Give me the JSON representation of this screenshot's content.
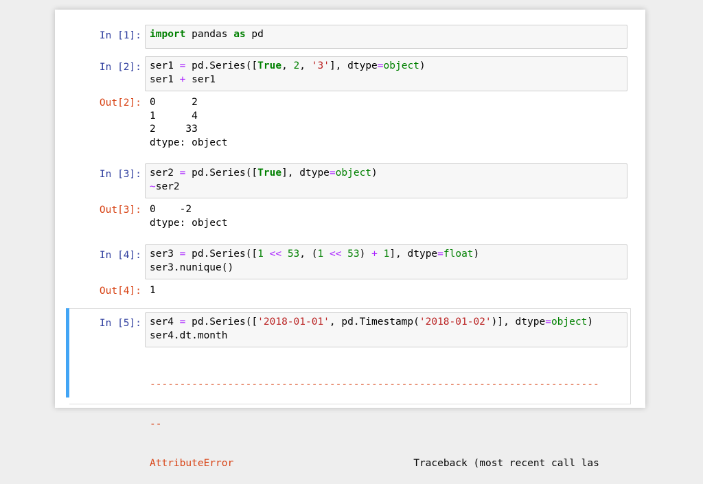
{
  "cells": [
    {
      "in_prompt": "In [1]:",
      "code": [
        [
          {
            "t": "import",
            "c": "kw"
          },
          {
            "t": " pandas "
          },
          {
            "t": "as",
            "c": "kw"
          },
          {
            "t": " pd"
          }
        ]
      ]
    },
    {
      "in_prompt": "In [2]:",
      "code": [
        [
          {
            "t": "ser1 "
          },
          {
            "t": "=",
            "c": "op"
          },
          {
            "t": " pd.Series(["
          },
          {
            "t": "True",
            "c": "kw"
          },
          {
            "t": ", "
          },
          {
            "t": "2",
            "c": "num"
          },
          {
            "t": ", "
          },
          {
            "t": "'3'",
            "c": "str"
          },
          {
            "t": "], dtype"
          },
          {
            "t": "=",
            "c": "op"
          },
          {
            "t": "object",
            "c": "cls"
          },
          {
            "t": ")"
          }
        ],
        [
          {
            "t": "ser1 "
          },
          {
            "t": "+",
            "c": "op"
          },
          {
            "t": " ser1"
          }
        ]
      ],
      "out_prompt": "Out[2]:",
      "output": [
        "0      2",
        "1      4",
        "2     33",
        "dtype: object"
      ]
    },
    {
      "in_prompt": "In [3]:",
      "code": [
        [
          {
            "t": "ser2 "
          },
          {
            "t": "=",
            "c": "op"
          },
          {
            "t": " pd.Series(["
          },
          {
            "t": "True",
            "c": "kw"
          },
          {
            "t": "], dtype"
          },
          {
            "t": "=",
            "c": "op"
          },
          {
            "t": "object",
            "c": "cls"
          },
          {
            "t": ")"
          }
        ],
        [
          {
            "t": "~",
            "c": "op"
          },
          {
            "t": "ser2"
          }
        ]
      ],
      "out_prompt": "Out[3]:",
      "output": [
        "0    -2",
        "dtype: object"
      ]
    },
    {
      "in_prompt": "In [4]:",
      "code": [
        [
          {
            "t": "ser3 "
          },
          {
            "t": "=",
            "c": "op"
          },
          {
            "t": " pd.Series(["
          },
          {
            "t": "1",
            "c": "num"
          },
          {
            "t": " "
          },
          {
            "t": "<<",
            "c": "op"
          },
          {
            "t": " "
          },
          {
            "t": "53",
            "c": "num"
          },
          {
            "t": ", ("
          },
          {
            "t": "1",
            "c": "num"
          },
          {
            "t": " "
          },
          {
            "t": "<<",
            "c": "op"
          },
          {
            "t": " "
          },
          {
            "t": "53",
            "c": "num"
          },
          {
            "t": ") "
          },
          {
            "t": "+",
            "c": "op"
          },
          {
            "t": " "
          },
          {
            "t": "1",
            "c": "num"
          },
          {
            "t": "], dtype"
          },
          {
            "t": "=",
            "c": "op"
          },
          {
            "t": "float",
            "c": "cls"
          },
          {
            "t": ")"
          }
        ],
        [
          {
            "t": "ser3.nunique()"
          }
        ]
      ],
      "out_prompt": "Out[4]:",
      "output": [
        "1"
      ]
    },
    {
      "in_prompt": "In [5]:",
      "code": [
        [
          {
            "t": "ser4 "
          },
          {
            "t": "=",
            "c": "op"
          },
          {
            "t": " pd.Series(["
          },
          {
            "t": "'2018-01-01'",
            "c": "str"
          },
          {
            "t": ", pd.Timestamp("
          },
          {
            "t": "'2018-01-02'",
            "c": "str"
          },
          {
            "t": ")], dtype"
          },
          {
            "t": "=",
            "c": "op"
          },
          {
            "t": "object",
            "c": "cls"
          },
          {
            "t": ")"
          }
        ],
        [
          {
            "t": "ser4.dt.month"
          }
        ]
      ],
      "error": {
        "dashes": "---------------------------------------------------------------------------",
        "dashes2": "--",
        "name": "AttributeError",
        "traceback": "Traceback (most recent call las"
      }
    }
  ],
  "colors": {
    "in_prompt": "#303f9f",
    "out_prompt": "#d84315",
    "keyword": "#008000",
    "operator": "#aa22ff",
    "string": "#ba2121",
    "selected_cell_bar": "#42a5f5"
  }
}
